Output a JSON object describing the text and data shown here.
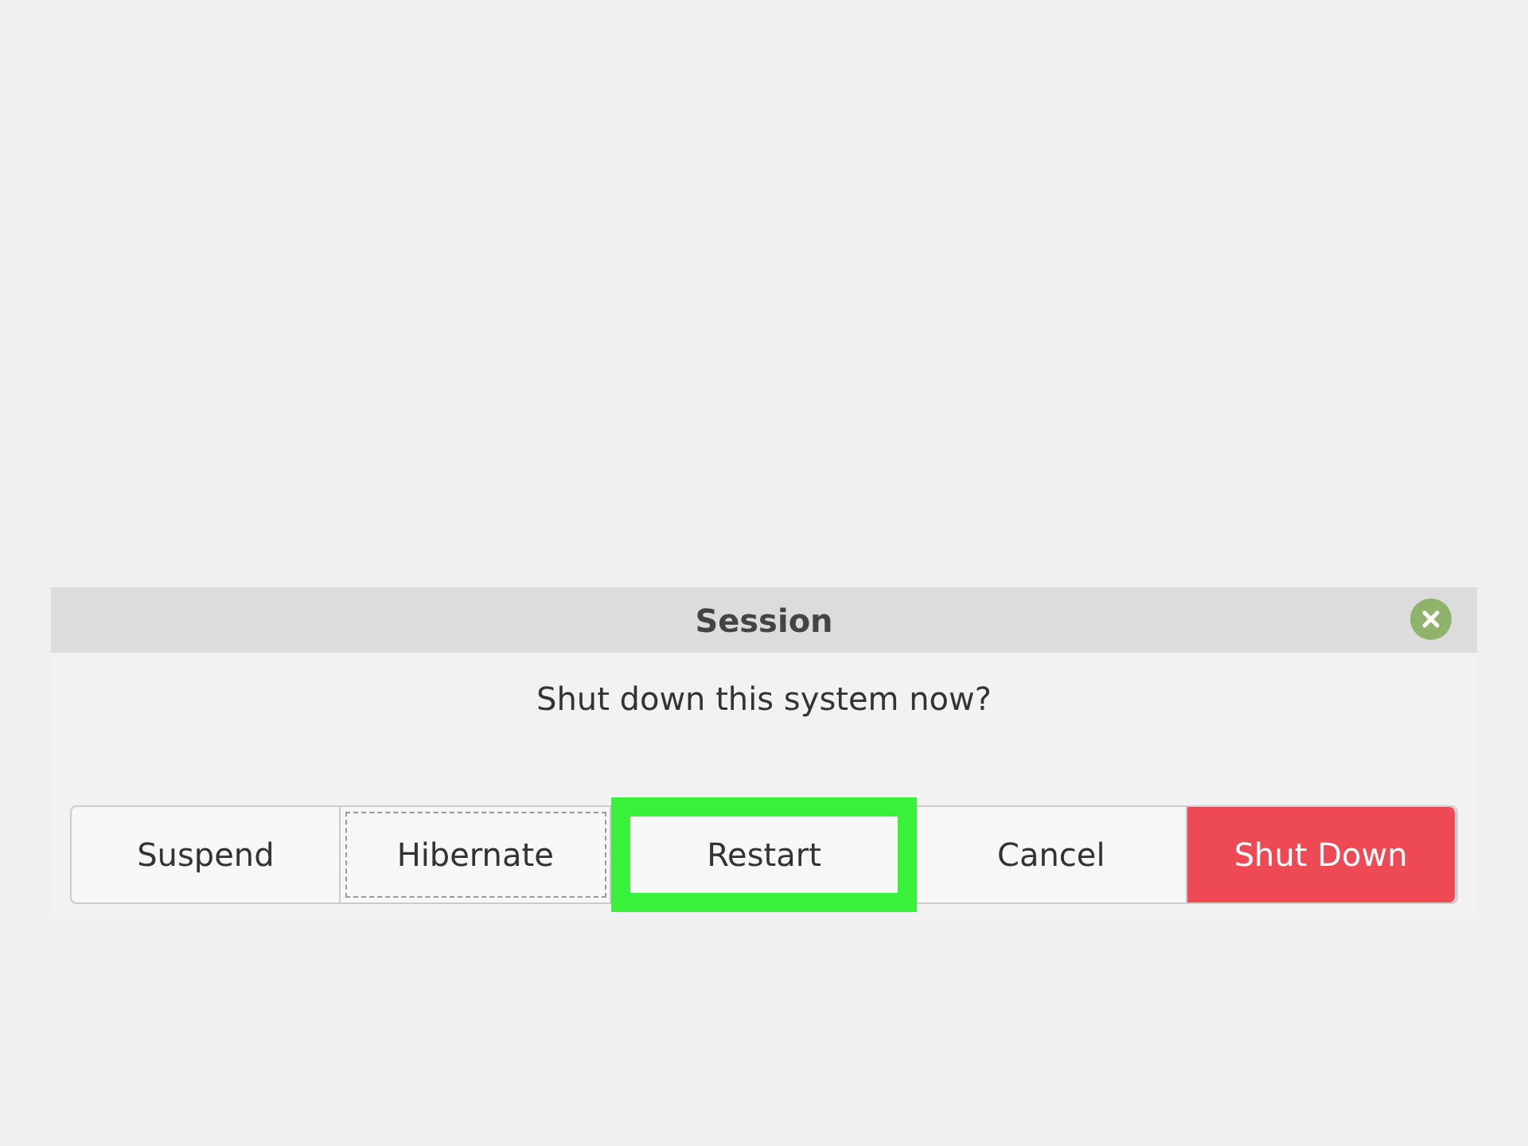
{
  "window": {
    "title": "Session"
  },
  "message": "Shut down this system now?",
  "buttons": [
    {
      "label": "Suspend",
      "kind": "default",
      "highlighted": false
    },
    {
      "label": "Hibernate",
      "kind": "focused",
      "highlighted": false
    },
    {
      "label": "Restart",
      "kind": "default",
      "highlighted": true
    },
    {
      "label": "Cancel",
      "kind": "default",
      "highlighted": false
    },
    {
      "label": "Shut Down",
      "kind": "destructive",
      "highlighted": false
    }
  ]
}
